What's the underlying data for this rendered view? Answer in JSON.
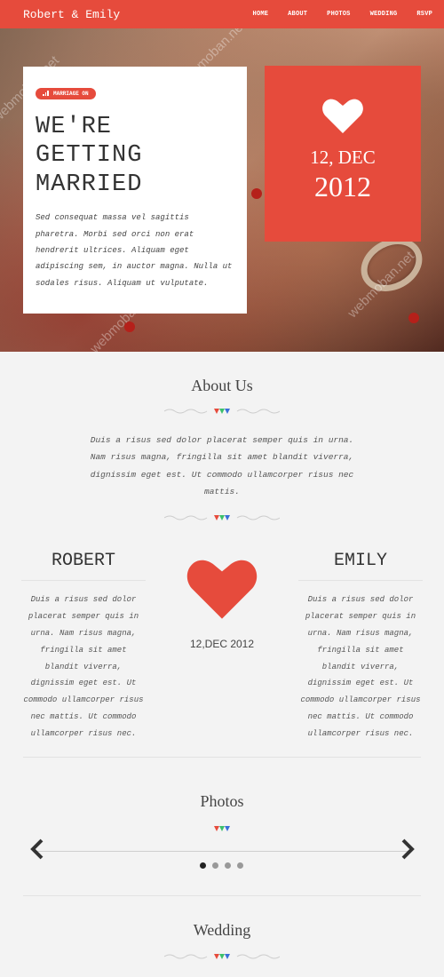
{
  "header": {
    "brand": "Robert & Emily",
    "nav": [
      "HOME",
      "ABOUT",
      "PHOTOS",
      "WEDDING",
      "RSVP"
    ]
  },
  "hero": {
    "badge": "MARRIAGE ON",
    "title": "WE'RE\nGETTING\nMARRIED",
    "text": "Sed consequat massa vel sagittis pharetra. Morbi sed orci non erat hendrerit ultrices. Aliquam eget adipiscing sem, in auctor magna. Nulla ut sodales risus. Aliquam ut vulputate.",
    "date_line1": "12, DEC",
    "date_line2": "2012"
  },
  "about": {
    "title": "About Us",
    "intro": "Duis a risus sed dolor placerat semper quis in urna. Nam risus magna, fringilla sit amet blandit viverra, dignissim eget est. Ut commodo ullamcorper risus nec mattis.",
    "groom": {
      "name": "ROBERT",
      "bio": "Duis a risus sed dolor placerat semper quis in urna. Nam risus magna, fringilla sit amet blandit viverra, dignissim eget est. Ut commodo ullamcorper risus nec mattis. Ut commodo ullamcorper risus nec."
    },
    "bride": {
      "name": "EMILY",
      "bio": "Duis a risus sed dolor placerat semper quis in urna. Nam risus magna, fringilla sit amet blandit viverra, dignissim eget est. Ut commodo ullamcorper risus nec mattis. Ut commodo ullamcorper risus nec."
    },
    "date": "12,DEC 2012"
  },
  "photos": {
    "title": "Photos",
    "dots_count": 4,
    "active_dot": 0
  },
  "wedding": {
    "title": "Wedding"
  },
  "watermark": "webmoban.net",
  "colors": {
    "accent": "#e64b3c",
    "divider_red": "#e64b3c",
    "divider_green": "#3bbf6b",
    "divider_blue": "#3a6fd8"
  }
}
